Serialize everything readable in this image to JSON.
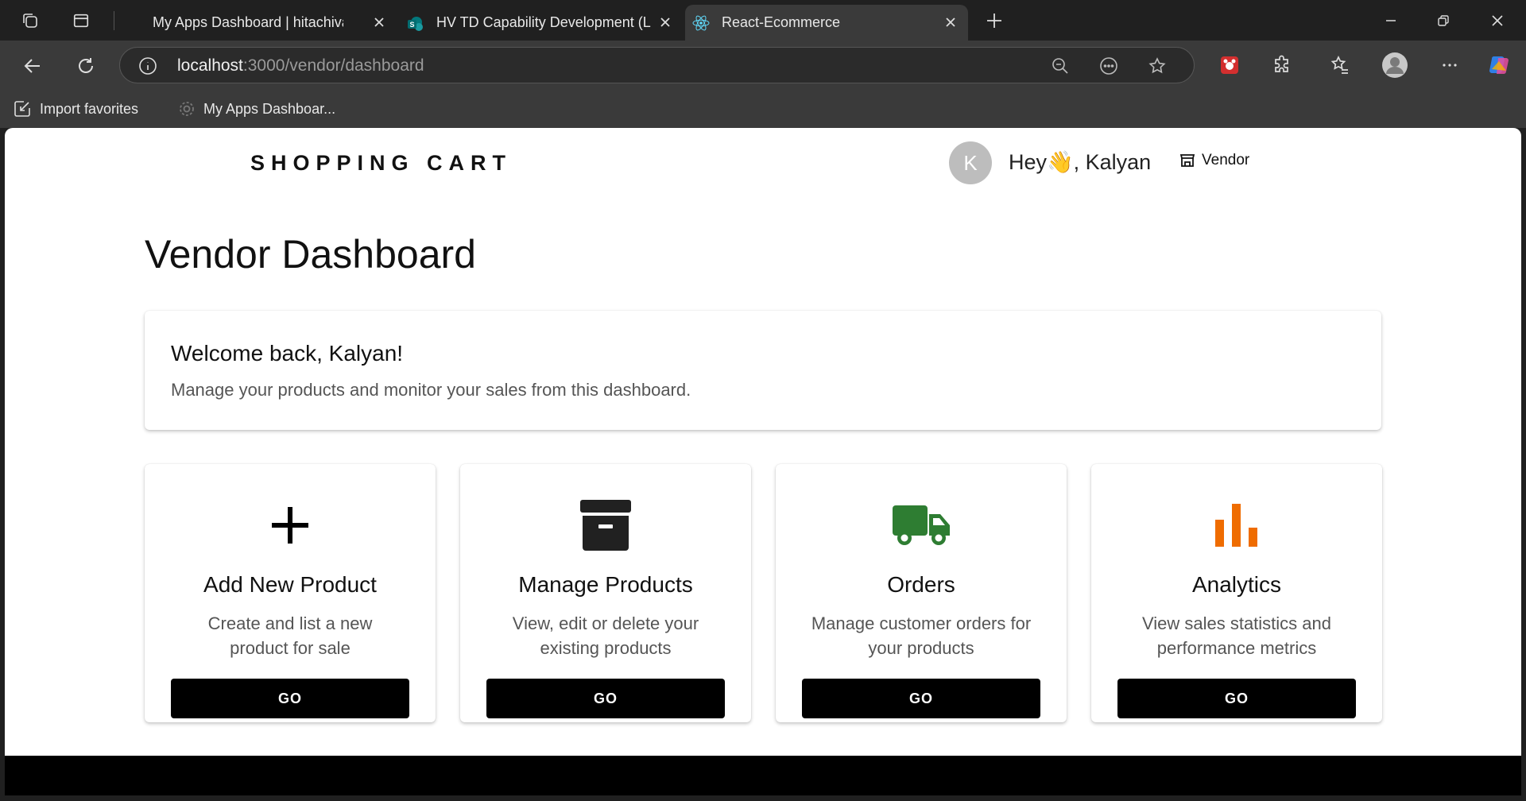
{
  "browser": {
    "tabs": [
      {
        "title": "My Apps Dashboard | hitachivanta",
        "active": false
      },
      {
        "title": "HV TD Capability Development (L",
        "active": false
      },
      {
        "title": "React-Ecommerce",
        "active": true
      }
    ],
    "url_host": "localhost",
    "url_path": ":3000/vendor/dashboard",
    "bookmarks": [
      {
        "label": "Import favorites",
        "icon": "import-icon"
      },
      {
        "label": "My Apps Dashboar...",
        "icon": "gear-icon"
      }
    ]
  },
  "header": {
    "logo": "SHOPPING CART",
    "avatar_initial": "K",
    "greeting": "Hey👋, Kalyan",
    "role_label": "Vendor"
  },
  "main": {
    "title": "Vendor Dashboard",
    "welcome": {
      "title": "Welcome back, Kalyan!",
      "subtitle": "Manage your products and monitor your sales from this dashboard."
    },
    "tiles": [
      {
        "icon": "plus-icon",
        "title": "Add New Product",
        "description": "Create and list a new product for sale",
        "button": "GO",
        "color": "#000000"
      },
      {
        "icon": "archive-box-icon",
        "title": "Manage Products",
        "description": "View, edit or delete your existing products",
        "button": "GO",
        "color": "#212121"
      },
      {
        "icon": "truck-icon",
        "title": "Orders",
        "description": "Manage customer orders for your products",
        "button": "GO",
        "color": "#2e7d32"
      },
      {
        "icon": "bar-chart-icon",
        "title": "Analytics",
        "description": "View sales statistics and performance metrics",
        "button": "GO",
        "color": "#ef6c00"
      }
    ]
  }
}
